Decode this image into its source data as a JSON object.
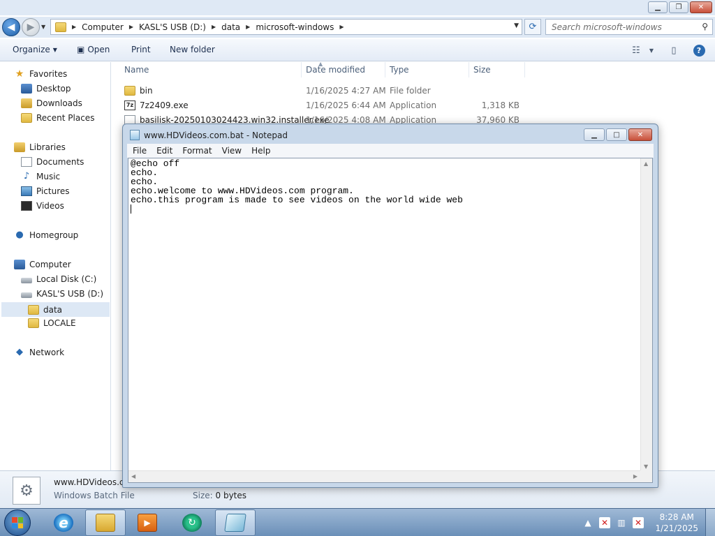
{
  "explorer": {
    "breadcrumb": [
      "Computer",
      "KASL'S USB (D:)",
      "data",
      "microsoft-windows"
    ],
    "search_placeholder": "Search microsoft-windows",
    "toolbar": {
      "organize": "Organize",
      "open": "Open",
      "print": "Print",
      "new_folder": "New folder"
    },
    "nav": {
      "favorites": "Favorites",
      "desktop": "Desktop",
      "downloads": "Downloads",
      "recent_places": "Recent Places",
      "libraries": "Libraries",
      "documents": "Documents",
      "music": "Music",
      "pictures": "Pictures",
      "videos": "Videos",
      "homegroup": "Homegroup",
      "computer": "Computer",
      "local_disk": "Local Disk (C:)",
      "usb": "KASL'S USB (D:)",
      "data": "data",
      "locale": "LOCALE",
      "network": "Network"
    },
    "columns": {
      "name": "Name",
      "date": "Date modified",
      "type": "Type",
      "size": "Size"
    },
    "files": [
      {
        "name": "bin",
        "date": "1/16/2025 4:27 AM",
        "type": "File folder",
        "size": ""
      },
      {
        "name": "7z2409.exe",
        "date": "1/16/2025 6:44 AM",
        "type": "Application",
        "size": "1,318 KB"
      },
      {
        "name": "basilisk-20250103024423.win32.installer.exe",
        "date": "1/16/2025 4:08 AM",
        "type": "Application",
        "size": "37,960 KB"
      }
    ],
    "details": {
      "filename": "www.HDVideos.c",
      "filetype": "Windows Batch File",
      "size_label": "Size:",
      "size_value": "0 bytes"
    }
  },
  "notepad": {
    "title": "www.HDVideos.com.bat - Notepad",
    "menu": [
      "File",
      "Edit",
      "Format",
      "View",
      "Help"
    ],
    "content": "@echo off\necho.\necho.\necho.welcome to www.HDVideos.com program.\necho.this program is made to see videos on the world wide web"
  },
  "taskbar": {
    "time": "8:28 AM",
    "date": "1/21/2025"
  }
}
